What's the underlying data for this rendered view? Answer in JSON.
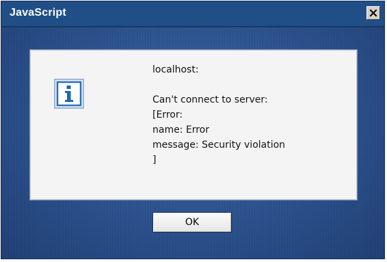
{
  "window": {
    "title": "JavaScript",
    "close_label": "close"
  },
  "message": {
    "origin": "localhost:",
    "lines": [
      "Can't connect to server:",
      "[Error:",
      "name: Error",
      "message: Security violation",
      "]"
    ]
  },
  "buttons": {
    "ok_label": "OK"
  },
  "colors": {
    "titlebar": "#1f4f86",
    "background": "#2a4f8a",
    "panel": "#f4f4f4",
    "icon_accent": "#1f66b5"
  },
  "icons": {
    "dialog_icon": "info-icon",
    "close_icon": "close-icon"
  }
}
